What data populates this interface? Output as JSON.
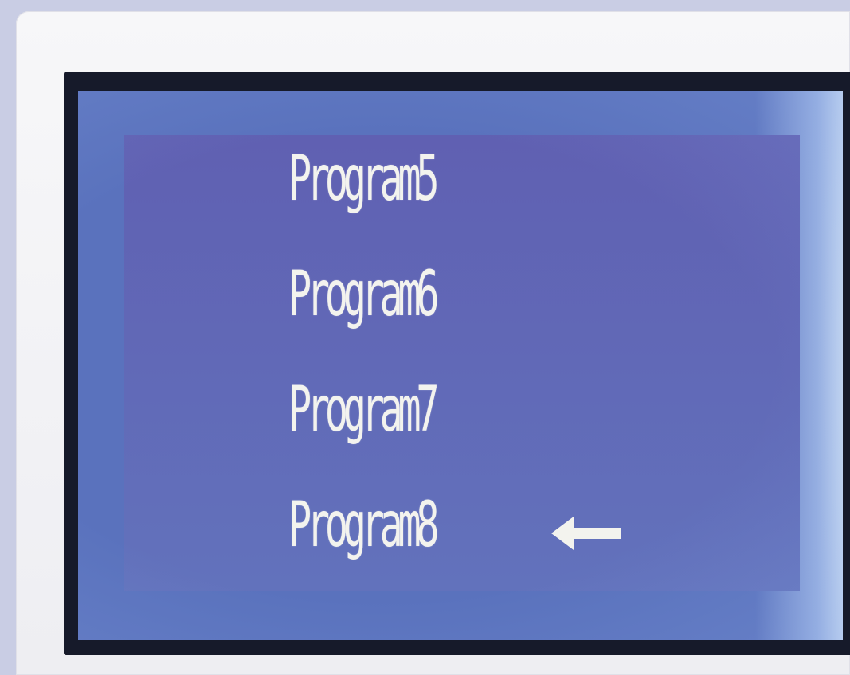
{
  "display": {
    "menu_items": [
      {
        "label": "Program5",
        "selected": false
      },
      {
        "label": "Program6",
        "selected": false
      },
      {
        "label": "Program7",
        "selected": false
      },
      {
        "label": "Program8",
        "selected": true
      }
    ],
    "selection_indicator_icon": "left-arrow-icon"
  },
  "colors": {
    "lcd_background": "#6060b2",
    "lcd_text": "#f3f3ee",
    "bezel": "#161a2a",
    "panel": "#f4f4f7"
  }
}
